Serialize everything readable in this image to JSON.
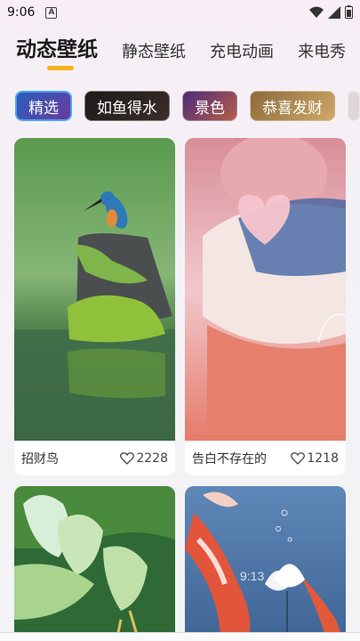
{
  "status": {
    "time": "9:06",
    "notification_icon": "A"
  },
  "tabs": [
    {
      "label": "动态壁纸",
      "active": true
    },
    {
      "label": "静态壁纸",
      "active": false
    },
    {
      "label": "充电动画",
      "active": false
    },
    {
      "label": "来电秀",
      "active": false
    }
  ],
  "chips": [
    {
      "label": "精选",
      "selected": true
    },
    {
      "label": "如鱼得水",
      "selected": false
    },
    {
      "label": "景色",
      "selected": false
    },
    {
      "label": "恭喜发财",
      "selected": false
    }
  ],
  "cards": [
    {
      "title": "招财鸟",
      "likes": "2228",
      "image": "kingfisher-on-rock"
    },
    {
      "title": "告白不存在的",
      "likes": "1218",
      "image": "pig-with-heart"
    },
    {
      "title": "",
      "likes": "",
      "image": "lotus-flower"
    },
    {
      "title": "",
      "likes": "",
      "image": "koi-fish-lotus",
      "overlay_text": "9:13"
    }
  ],
  "colors": {
    "accent": "#f4b41a",
    "active_chip_border": "#4aa3ff"
  }
}
